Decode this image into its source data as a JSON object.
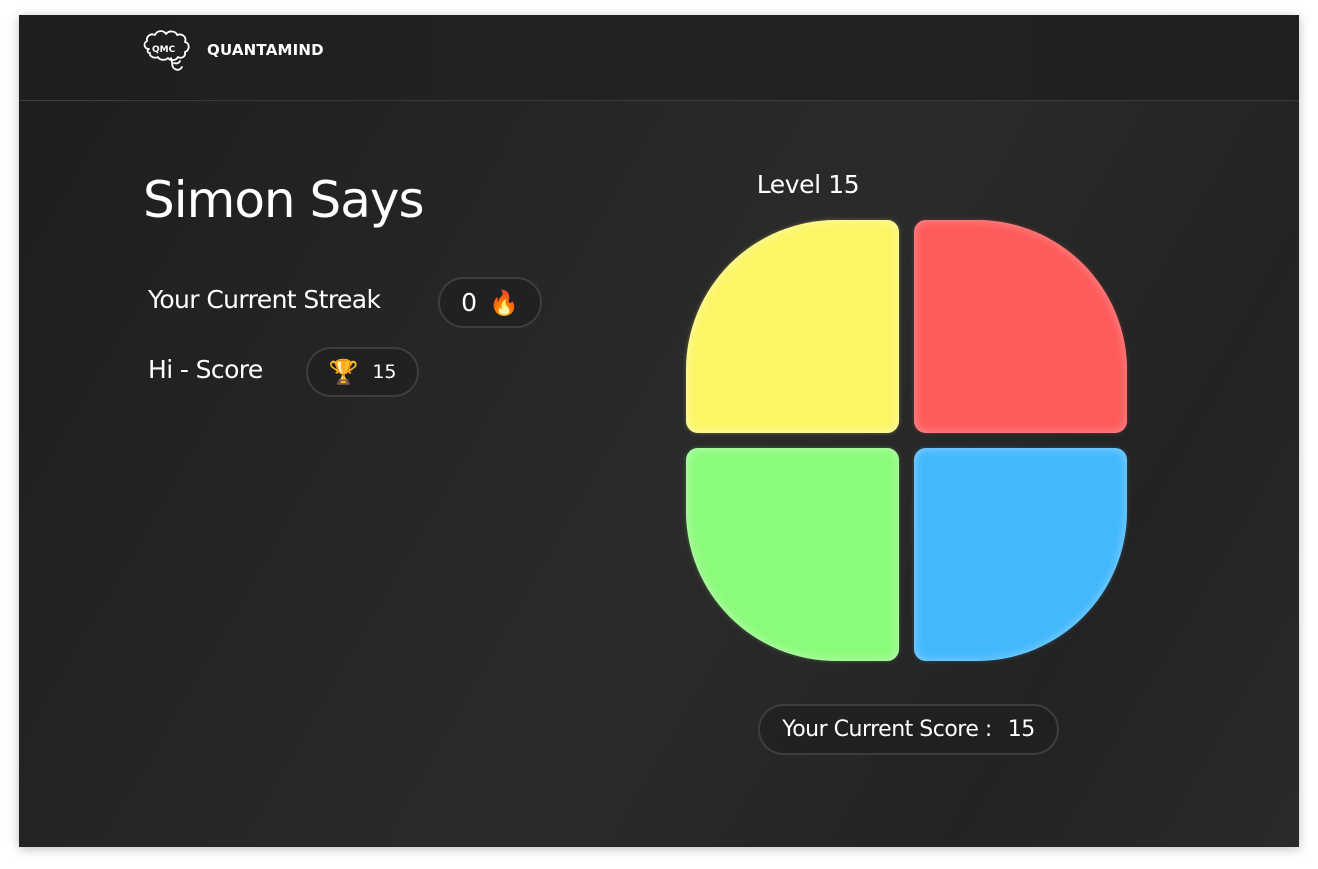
{
  "header": {
    "brand": "QUANTAMIND",
    "logo_icon": "brain-icon",
    "logo_text": "QMC"
  },
  "game": {
    "title": "Simon Says",
    "streak_label": "Your Current Streak",
    "streak_value": "0",
    "streak_icon": "fire-icon",
    "hiscore_label": "Hi - Score",
    "hiscore_value": "15",
    "hiscore_icon": "trophy-icon",
    "level_text": "Level 15",
    "score_label": "Your Current Score :",
    "score_value": "15"
  },
  "pads": [
    {
      "name": "yellow",
      "color": "#fcf665"
    },
    {
      "name": "red",
      "color": "#fe5b5b"
    },
    {
      "name": "green",
      "color": "#8bfb7b"
    },
    {
      "name": "blue",
      "color": "#43b8fd"
    }
  ],
  "colors": {
    "background": "#242424",
    "text": "#ffffff",
    "pill_border": "#3e3e3e"
  }
}
